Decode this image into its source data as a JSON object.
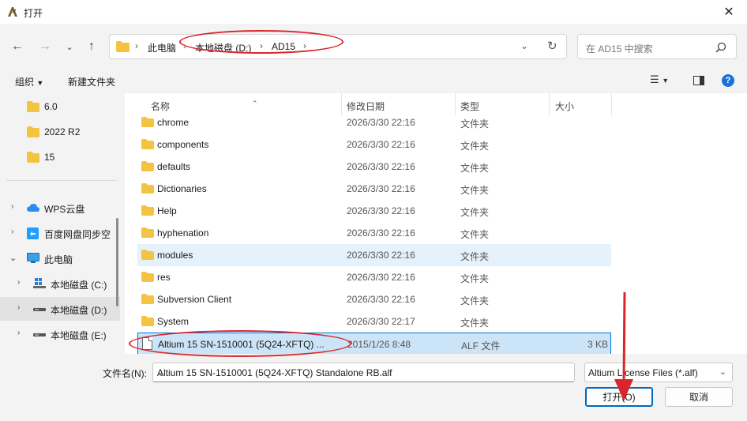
{
  "window": {
    "title": "打开"
  },
  "breadcrumb": [
    "此电脑",
    "本地磁盘 (D:)",
    "AD15"
  ],
  "search": {
    "placeholder": "在 AD15 中搜索"
  },
  "toolbar": {
    "organize": "组织",
    "new_folder": "新建文件夹"
  },
  "sidebar": {
    "items": [
      {
        "label": "6.0",
        "icon": "folder-icon"
      },
      {
        "label": "2022 R2",
        "icon": "folder-icon"
      },
      {
        "label": "15",
        "icon": "folder-icon"
      },
      {
        "label": "WPS云盘",
        "icon": "cloud-icon"
      },
      {
        "label": "百度网盘同步空",
        "icon": "baidu-sync-icon"
      },
      {
        "label": "此电脑",
        "icon": "computer-icon"
      },
      {
        "label": "本地磁盘 (C:)",
        "icon": "drive-c-icon"
      },
      {
        "label": "本地磁盘 (D:)",
        "icon": "drive-icon"
      },
      {
        "label": "本地磁盘 (E:)",
        "icon": "drive-icon"
      }
    ]
  },
  "columns": {
    "name": "名称",
    "date": "修改日期",
    "type": "类型",
    "size": "大小"
  },
  "files": [
    {
      "name": "chrome",
      "date": "2026/3/30 22:16",
      "type": "文件夹",
      "size": ""
    },
    {
      "name": "components",
      "date": "2026/3/30 22:16",
      "type": "文件夹",
      "size": ""
    },
    {
      "name": "defaults",
      "date": "2026/3/30 22:16",
      "type": "文件夹",
      "size": ""
    },
    {
      "name": "Dictionaries",
      "date": "2026/3/30 22:16",
      "type": "文件夹",
      "size": ""
    },
    {
      "name": "Help",
      "date": "2026/3/30 22:16",
      "type": "文件夹",
      "size": ""
    },
    {
      "name": "hyphenation",
      "date": "2026/3/30 22:16",
      "type": "文件夹",
      "size": ""
    },
    {
      "name": "modules",
      "date": "2026/3/30 22:16",
      "type": "文件夹",
      "size": ""
    },
    {
      "name": "res",
      "date": "2026/3/30 22:16",
      "type": "文件夹",
      "size": ""
    },
    {
      "name": "Subversion Client",
      "date": "2026/3/30 22:16",
      "type": "文件夹",
      "size": ""
    },
    {
      "name": "System",
      "date": "2026/3/30 22:17",
      "type": "文件夹",
      "size": ""
    },
    {
      "name": "Altium 15 SN-1510001 (5Q24-XFTQ) ...",
      "date": "2015/1/26 8:48",
      "type": "ALF 文件",
      "size": "3 KB"
    }
  ],
  "bottom": {
    "filename_label": "文件名(N):",
    "filename_value": "Altium 15 SN-1510001 (5Q24-XFTQ) Standalone RB.alf",
    "filter": "Altium License Files (*.alf)",
    "open": "打开(O)",
    "cancel": "取消"
  },
  "colors": {
    "annotation": "#d8262a",
    "accent": "#0078d7",
    "folder": "#f5c342"
  }
}
